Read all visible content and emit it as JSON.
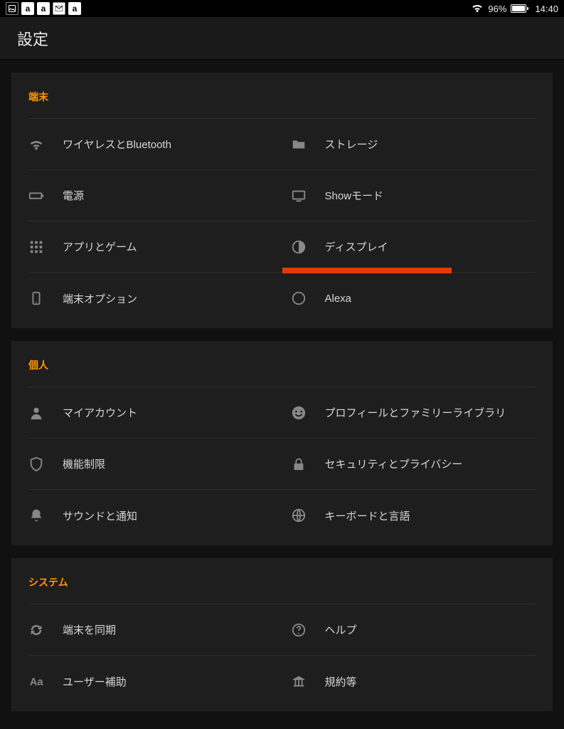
{
  "statusbar": {
    "battery_pct": "96%",
    "time": "14:40"
  },
  "appbar": {
    "title": "設定"
  },
  "sections": [
    {
      "title": "端末",
      "items": [
        {
          "icon": "wifi",
          "label": "ワイヤレスとBluetooth"
        },
        {
          "icon": "folder",
          "label": "ストレージ"
        },
        {
          "icon": "battery",
          "label": "電源"
        },
        {
          "icon": "monitor",
          "label": "Showモード"
        },
        {
          "icon": "apps",
          "label": "アプリとゲーム"
        },
        {
          "icon": "contrast",
          "label": "ディスプレイ",
          "highlight": true
        },
        {
          "icon": "tablet",
          "label": "端末オプション"
        },
        {
          "icon": "alexa",
          "label": "Alexa"
        }
      ]
    },
    {
      "title": "個人",
      "items": [
        {
          "icon": "person",
          "label": "マイアカウント"
        },
        {
          "icon": "smiley",
          "label": "プロフィールとファミリーライブラリ"
        },
        {
          "icon": "shield",
          "label": "機能制限"
        },
        {
          "icon": "lock",
          "label": "セキュリティとプライバシー"
        },
        {
          "icon": "bell",
          "label": "サウンドと通知"
        },
        {
          "icon": "globe",
          "label": "キーボードと言語"
        }
      ]
    },
    {
      "title": "システム",
      "items": [
        {
          "icon": "sync",
          "label": "端末を同期"
        },
        {
          "icon": "help",
          "label": "ヘルプ"
        },
        {
          "icon": "text",
          "label": "ユーザー補助"
        },
        {
          "icon": "legal",
          "label": "規約等"
        }
      ]
    }
  ]
}
